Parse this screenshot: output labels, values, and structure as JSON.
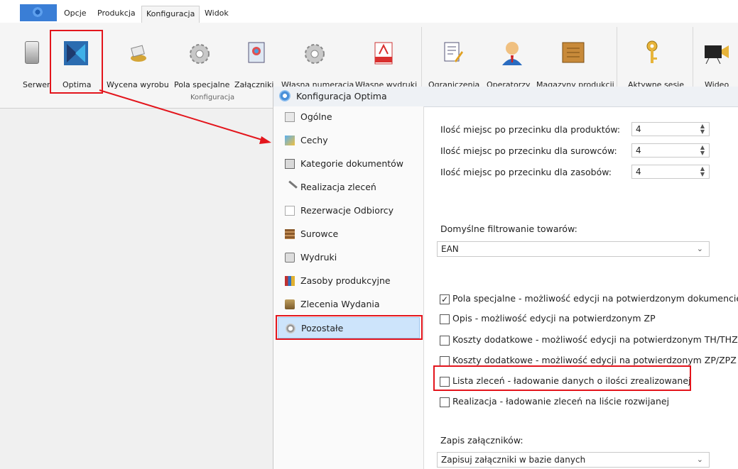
{
  "ribbon": {
    "tabs": [
      "Opcje",
      "Produkcja",
      "Konfiguracja",
      "Widok"
    ],
    "active_tab": "Konfiguracja",
    "buttons": [
      "Serwer",
      "Optima",
      "Wycena wyrobu",
      "Pola specjalne",
      "Załączniki",
      "Własna numeracja",
      "Własne wydruki",
      "Ograniczenia",
      "Operatorzy",
      "Magazyny produkcji",
      "Aktywne sesje",
      "Wideo"
    ],
    "group_label": "Konfiguracja"
  },
  "dialog": {
    "title": "Konfiguracja Optima",
    "nav": [
      "Ogólne",
      "Cechy",
      "Kategorie dokumentów",
      "Realizacja zleceń",
      "Rezerwacje Odbiorcy",
      "Surowce",
      "Wydruki",
      "Zasoby produkcyjne",
      "Zlecenia Wydania",
      "Pozostałe"
    ],
    "selected_nav": "Pozostałe"
  },
  "settings": {
    "decimals": [
      {
        "label": "Ilość miejsc po przecinku dla produktów:",
        "value": "4"
      },
      {
        "label": "Ilość miejsc po przecinku dla surowców:",
        "value": "4"
      },
      {
        "label": "Ilość miejsc po przecinku dla zasobów:",
        "value": "4"
      }
    ],
    "filter_label": "Domyślne filtrowanie towarów:",
    "filter_value": "EAN",
    "checkboxes": [
      {
        "label": "Pola specjalne - możliwość edycji na potwierdzonym dokumencie",
        "checked": true
      },
      {
        "label": "Opis - możliwość edycji na potwierdzonym ZP",
        "checked": false
      },
      {
        "label": "Koszty dodatkowe - możliwość edycji na potwierdzonym TH/THZ",
        "checked": false
      },
      {
        "label": "Koszty dodatkowe - możliwość edycji na potwierdzonym ZP/ZPZ",
        "checked": false
      },
      {
        "label": "Lista zleceń - ładowanie danych o ilości zrealizowanej",
        "checked": false
      },
      {
        "label": "Realizacja - ładowanie zleceń na liście rozwijanej",
        "checked": false
      }
    ],
    "attachments_label": "Zapis załączników:",
    "attachments_value": "Zapisuj załączniki w bazie danych"
  },
  "colors": {
    "highlight": "#e3151c",
    "selected_bg": "#cde4fb"
  }
}
